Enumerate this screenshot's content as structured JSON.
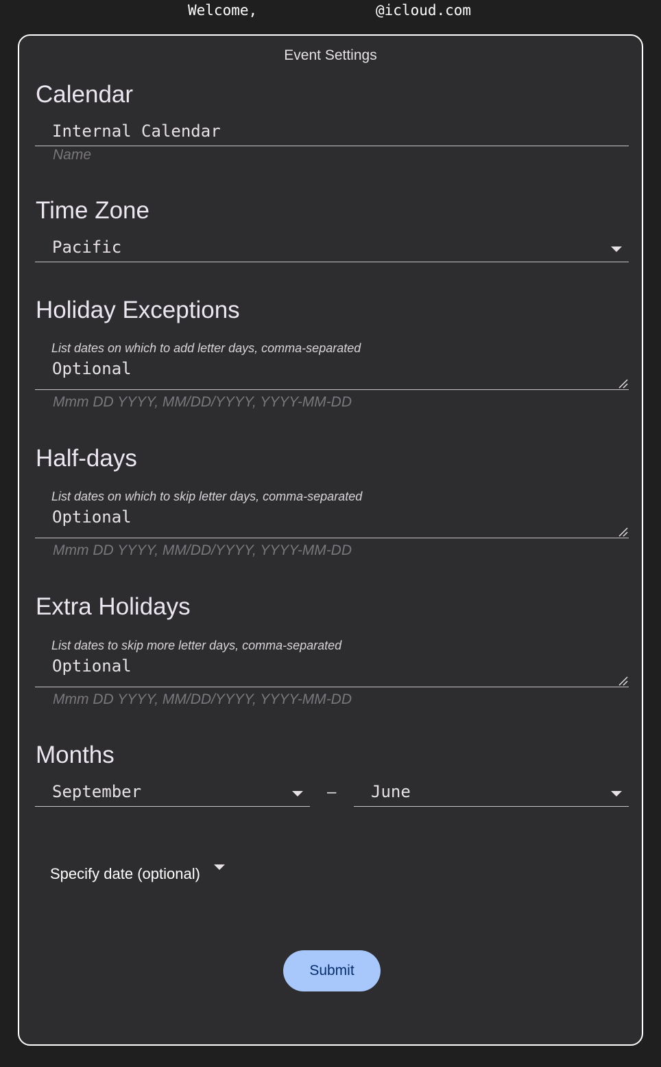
{
  "header": {
    "welcome_label": "Welcome,",
    "email_suffix": "@icloud.com"
  },
  "card": {
    "title": "Event Settings"
  },
  "calendar": {
    "title": "Calendar",
    "value": "Internal Calendar",
    "helper": "Name"
  },
  "timezone": {
    "title": "Time Zone",
    "selected": "Pacific"
  },
  "holiday_exceptions": {
    "title": "Holiday Exceptions",
    "label": "List dates on which to add letter days, comma-separated",
    "placeholder": "Optional",
    "helper": "Mmm DD YYYY, MM/DD/YYYY, YYYY-MM-DD"
  },
  "half_days": {
    "title": "Half-days",
    "label": "List dates on which to skip letter days, comma-separated",
    "placeholder": "Optional",
    "helper": "Mmm DD YYYY, MM/DD/YYYY, YYYY-MM-DD"
  },
  "extra_holidays": {
    "title": "Extra Holidays",
    "label": "List dates to skip more letter days, comma-separated",
    "placeholder": "Optional",
    "helper": "Mmm DD YYYY, MM/DD/YYYY, YYYY-MM-DD"
  },
  "months": {
    "title": "Months",
    "start": "September",
    "separator": "–",
    "end": "June"
  },
  "specify_date": {
    "label": "Specify date (optional)"
  },
  "submit": {
    "label": "Submit"
  },
  "colors": {
    "background": "#1f1f1f",
    "card": "#2d2d2f",
    "accent": "#a8c7fa",
    "accent_text": "#062e6f"
  }
}
